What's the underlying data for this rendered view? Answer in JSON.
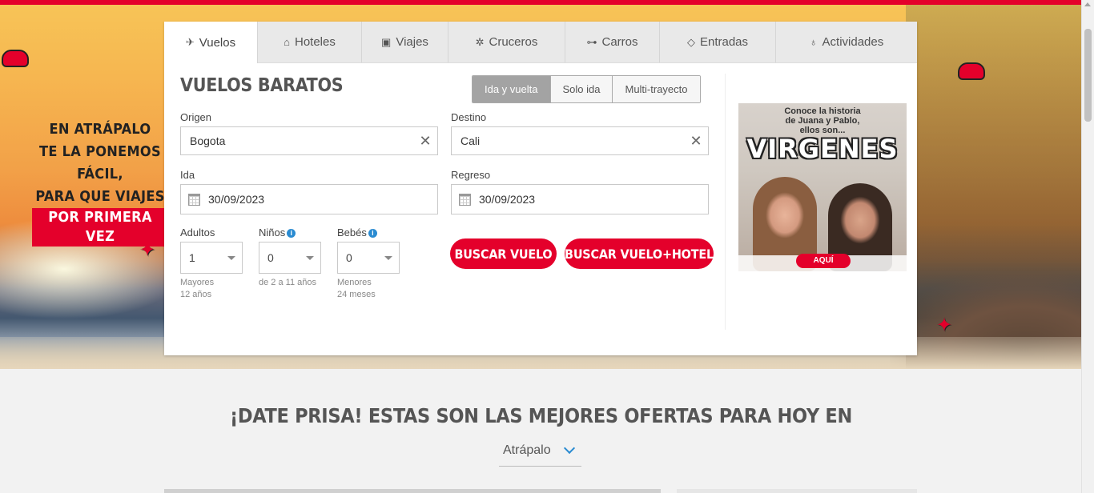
{
  "promo": {
    "lines": [
      "EN ATRÁPALO",
      "TE LA PONEMOS",
      "FÁCIL,",
      "PARA QUE VIAJES"
    ],
    "highlight": "POR PRIMERA VEZ"
  },
  "tabs": [
    {
      "label": "Vuelos",
      "icon": "plane-icon",
      "glyph": "✈",
      "active": true
    },
    {
      "label": "Hoteles",
      "icon": "bed-icon",
      "glyph": "⌂",
      "active": false
    },
    {
      "label": "Viajes",
      "icon": "suitcase-icon",
      "glyph": "▣",
      "active": false
    },
    {
      "label": "Cruceros",
      "icon": "ship-wheel-icon",
      "glyph": "✲",
      "active": false
    },
    {
      "label": "Carros",
      "icon": "car-icon",
      "glyph": "⊶",
      "active": false
    },
    {
      "label": "Entradas",
      "icon": "ticket-icon",
      "glyph": "◇",
      "active": false
    },
    {
      "label": "Actividades",
      "icon": "balloon-icon",
      "glyph": "♁",
      "active": false
    }
  ],
  "search": {
    "title": "VUELOS BARATOS",
    "trip_types": [
      "Ida y vuelta",
      "Solo ida",
      "Multi-trayecto"
    ],
    "trip_selected": "Ida y vuelta",
    "origin": {
      "label": "Origen",
      "value": "Bogota"
    },
    "destination": {
      "label": "Destino",
      "value": "Cali"
    },
    "depart": {
      "label": "Ida",
      "value": "30/09/2023"
    },
    "return": {
      "label": "Regreso",
      "value": "30/09/2023"
    },
    "adults": {
      "label": "Adultos",
      "value": "1",
      "hint_1": "Mayores",
      "hint_2": "12 años"
    },
    "children": {
      "label": "Niños",
      "value": "0",
      "hint_1": "de 2 a 11 años"
    },
    "infants": {
      "label": "Bebés",
      "value": "0",
      "hint_1": "Menores",
      "hint_2": "24 meses"
    },
    "btn_flight": "BUSCAR VUELO",
    "btn_flight_hotel": "BUSCAR VUELO+HOTEL"
  },
  "ad": {
    "line1": "Conoce la historia",
    "line2": "de Juana y Pablo,",
    "line3": "ellos son...",
    "headline": "VIRGENES",
    "cta": "AQUÍ"
  },
  "offers": {
    "title": "¡DATE PRISA! ESTAS SON LAS MEJORES OFERTAS PARA HOY EN",
    "site": "Atrápalo"
  },
  "colors": {
    "brand_red": "#e4002b",
    "info_blue": "#2a8bd1"
  }
}
